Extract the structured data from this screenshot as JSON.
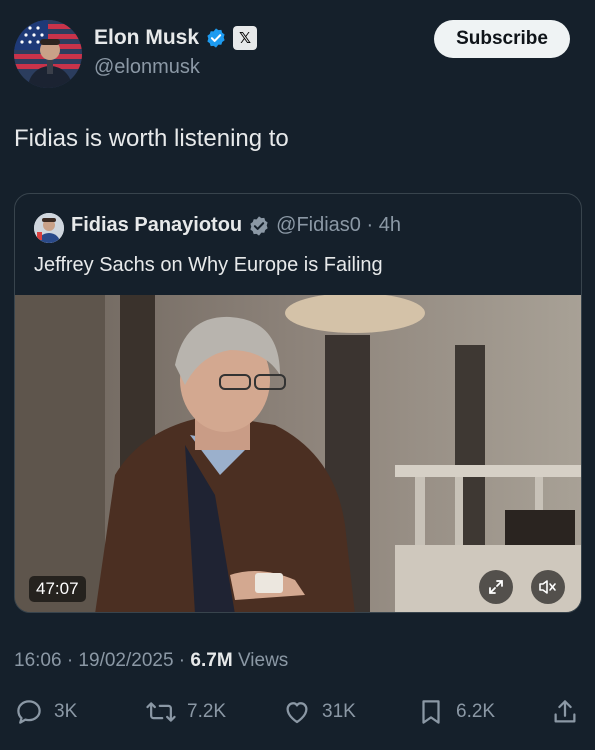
{
  "author": {
    "name": "Elon Musk",
    "handle": "@elonmusk",
    "verified_icon": "verified-badge-icon",
    "affiliate_icon": "x-logo-icon",
    "affiliate_glyph": "𝕏"
  },
  "subscribe_label": "Subscribe",
  "tweet_text": "Fidias is worth listening to",
  "quote": {
    "author_name": "Fidias Panayiotou",
    "handle_time": "@Fidias0 · 4h",
    "text": "Jeffrey Sachs on Why Europe is Failing",
    "video": {
      "duration": "47:07",
      "expand_icon": "expand-icon",
      "mute_icon": "mute-icon"
    }
  },
  "meta": {
    "timestamp": "16:06 · 19/02/2025 · ",
    "views_count": "6.7M",
    "views_label": " Views"
  },
  "actions": {
    "replies": "3K",
    "reposts": "7.2K",
    "likes": "31K",
    "bookmarks": "6.2K"
  },
  "colors": {
    "background": "#15202b",
    "verified": "#1d9bf0",
    "muted_text": "#8b98a5"
  }
}
